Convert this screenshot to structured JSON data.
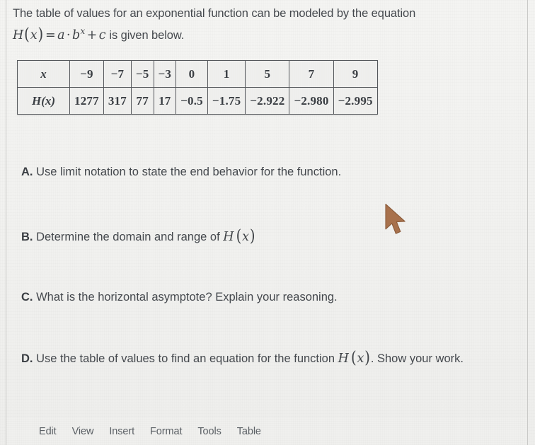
{
  "prompt": {
    "line1": "The table of values for an exponential function can be modeled by the equation",
    "equation_plain": "H(x) = a · b^x + c",
    "equation": {
      "fn": "H",
      "open": "(",
      "var": "x",
      "close": ")",
      "equals": "=",
      "coef": "a",
      "dot": "·",
      "base": "b",
      "exponent": "x",
      "plus": "+",
      "const": "c"
    },
    "line2_tail": " is given below."
  },
  "table": {
    "row_labels": [
      "x",
      "H(x)"
    ],
    "x_values": [
      "−9",
      "−7",
      "−5",
      "−3",
      "0",
      "1",
      "5",
      "7",
      "9"
    ],
    "h_values": [
      "1277",
      "317",
      "77",
      "17",
      "−0.5",
      "−1.75",
      "−2.922",
      "−2.980",
      "−2.995"
    ]
  },
  "questions": [
    {
      "label": "A.",
      "text": " Use limit notation to state the end behavior for the function.",
      "math_suffix": ""
    },
    {
      "label": "B.",
      "text": " Determine the domain and range of ",
      "math_suffix": "H (x)"
    },
    {
      "label": "C.",
      "text": " What is the horizontal asymptote? Explain your reasoning.",
      "math_suffix": ""
    },
    {
      "label": "D.",
      "text": " Use the table of values to find an equation for the function ",
      "math_suffix": "H (x)",
      "text_after": ". Show your work."
    }
  ],
  "menubar": {
    "items": [
      "Edit",
      "View",
      "Insert",
      "Format",
      "Tools",
      "Table"
    ]
  },
  "colors": {
    "page_background": "#f1f1ef",
    "text": "#44484d",
    "table_border": "#55585c",
    "cursor": "#a8714c",
    "frame_line": "#c9c9c7"
  }
}
